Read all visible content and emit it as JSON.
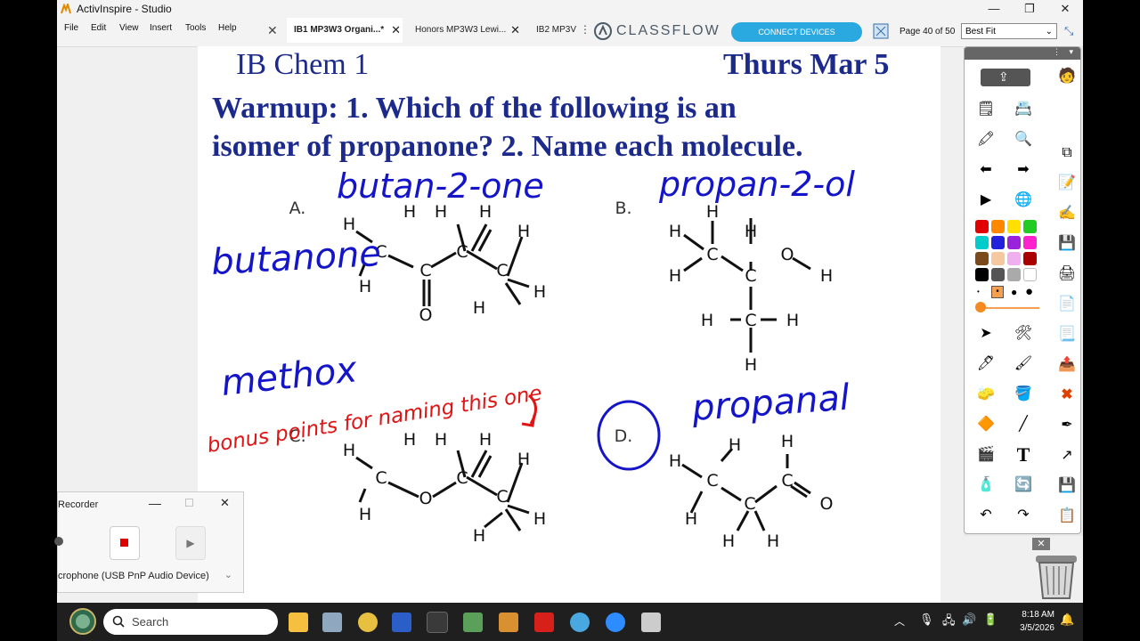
{
  "window": {
    "title": "ActivInspire - Studio",
    "minimize": "—",
    "restore": "❐",
    "close": "✕"
  },
  "menu": [
    "File",
    "Edit",
    "View",
    "Insert",
    "Tools",
    "Help"
  ],
  "tabs": [
    {
      "label": "IB1 MP3W3 Organi...*",
      "active": true
    },
    {
      "label": "Honors MP3W3 Lewi...",
      "active": false
    },
    {
      "label": "IB2 MP3V",
      "active": false
    }
  ],
  "classflow": {
    "logo": "CLASSFLOW",
    "connect_label": "CONNECT DEVICES"
  },
  "page_info": "Page 40 of 50",
  "zoom": {
    "selected": "Best Fit"
  },
  "slide": {
    "header_left": "IB Chem 1",
    "header_right": "Thurs Mar 5",
    "warmup_line1": "Warmup: 1. Which of the following is an",
    "warmup_line2": "isomer of propanone?  2. Name each molecule.",
    "option_a": "A.",
    "option_b": "B.",
    "option_c": "C.",
    "option_d": "D."
  },
  "handwriting": {
    "a_name": "butan-2-one",
    "a_alt": "butanone",
    "b_name": "propan-2-ol",
    "c_name": "methox",
    "c_bonus": "bonus points for naming this one",
    "d_name": "propanal"
  },
  "atoms": {
    "h": "H",
    "c": "C",
    "o": "O"
  },
  "palette": {
    "colors": [
      "#e00000",
      "#ff8800",
      "#ffe000",
      "#22cc22",
      "#00cccc",
      "#2222dd",
      "#9a22dd",
      "#ff22cc",
      "#7a4a1a",
      "#f5c8a0",
      "#f0b0f0",
      "#aa0000",
      "#000000",
      "#555555",
      "#aaaaaa",
      "#ffffff"
    ],
    "accent": "#2aa8e0"
  },
  "recorder": {
    "title": "Recorder",
    "device": "crophone (USB PnP Audio Device)"
  },
  "taskbar": {
    "search_placeholder": "Search",
    "time": "8:18 AM",
    "date": "3/5/2026"
  }
}
